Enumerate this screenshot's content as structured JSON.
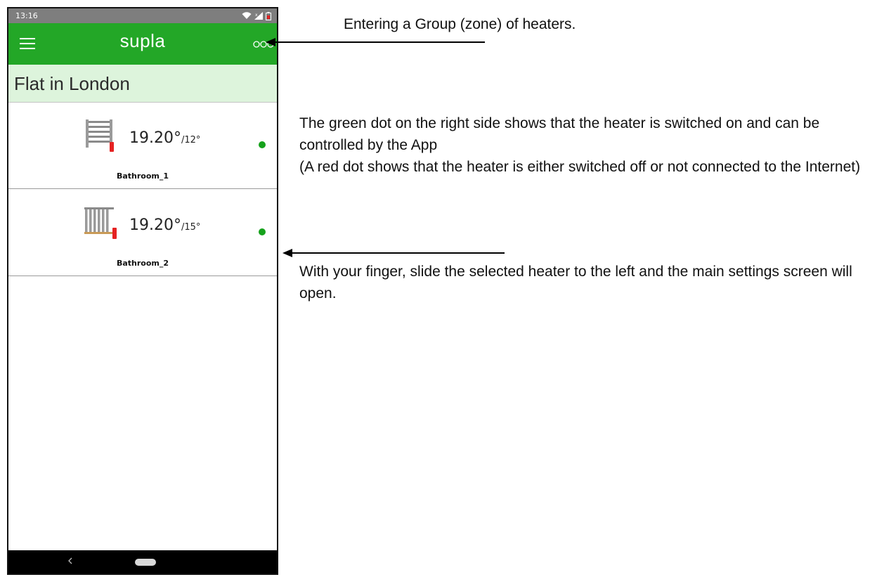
{
  "status_bar": {
    "time": "13:16",
    "icons": [
      "wifi-icon",
      "cellular-signal-icon",
      "battery-icon"
    ]
  },
  "app_bar": {
    "title": "supla",
    "menu_icon": "hamburger-menu-icon",
    "group_icon": "three-circles-group-icon"
  },
  "location": {
    "name": "Flat in London"
  },
  "channels": [
    {
      "name": "Bathroom_1",
      "temperature": "19.20°",
      "separator": "/",
      "setpoint": "12°",
      "icon": "towel-rail-heater-icon",
      "status": "online",
      "status_color": "#16a21c"
    },
    {
      "name": "Bathroom_2",
      "temperature": "19.20°",
      "separator": "/",
      "setpoint": "15°",
      "icon": "radiator-heater-icon",
      "status": "online",
      "status_color": "#16a21c"
    }
  ],
  "nav_bar": {
    "icons": [
      "back-chevron-icon",
      "home-pill-icon"
    ]
  },
  "annotations": {
    "group_hint": "Entering a Group (zone) of heaters.",
    "dot_hint_line1": "The green dot on the right side shows that the heater is switched on and can be controlled by the App",
    "dot_hint_line2": "(A red dot shows that the heater is either switched off or not connected to the Internet)",
    "slide_hint": "With your finger, slide the selected heater to the left and the main settings screen will open."
  },
  "colors": {
    "app_bar": "#23a727",
    "location_header": "#ddf4dc",
    "status_bar": "#7e7e7e",
    "online_dot": "#16a21c",
    "heater_accent": "#e52222"
  }
}
